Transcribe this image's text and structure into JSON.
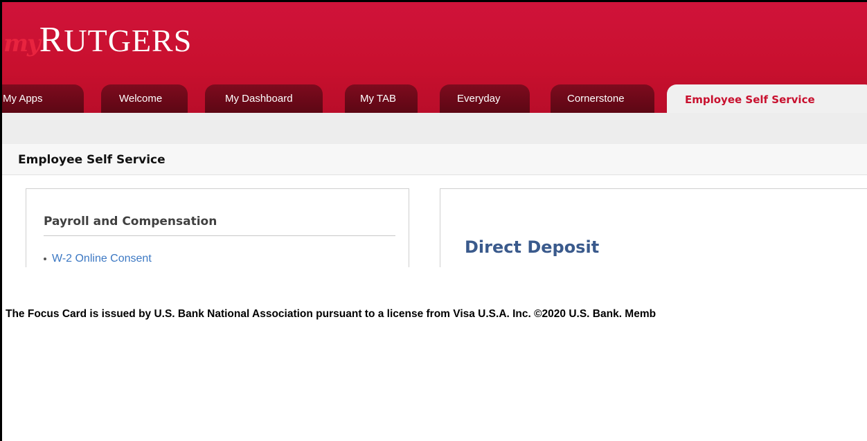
{
  "header": {
    "logo_my": "my",
    "logo_first": "R",
    "logo_rest": "UTGERS"
  },
  "tabs": [
    {
      "label": "My Apps"
    },
    {
      "label": "Welcome"
    },
    {
      "label": "My Dashboard"
    },
    {
      "label": "My TAB"
    },
    {
      "label": "Everyday"
    },
    {
      "label": "Cornerstone"
    }
  ],
  "active_tab": {
    "label": "Employee Self Service"
  },
  "page_title": "Employee Self Service",
  "left_panel": {
    "heading": "Payroll and Compensation",
    "links": [
      "W-2 Online Consent"
    ]
  },
  "right_panel": {
    "heading": "Direct Deposit"
  },
  "disclaimer": "The Focus Card is issued by U.S. Bank National Association pursuant to a license from Visa U.S.A. Inc. ©2020 U.S. Bank. Memb",
  "colors": {
    "brand_red": "#c8102e",
    "tab_dark": "#6b0918",
    "link_blue": "#3c78c3",
    "heading_blue": "#3a5a8c"
  }
}
